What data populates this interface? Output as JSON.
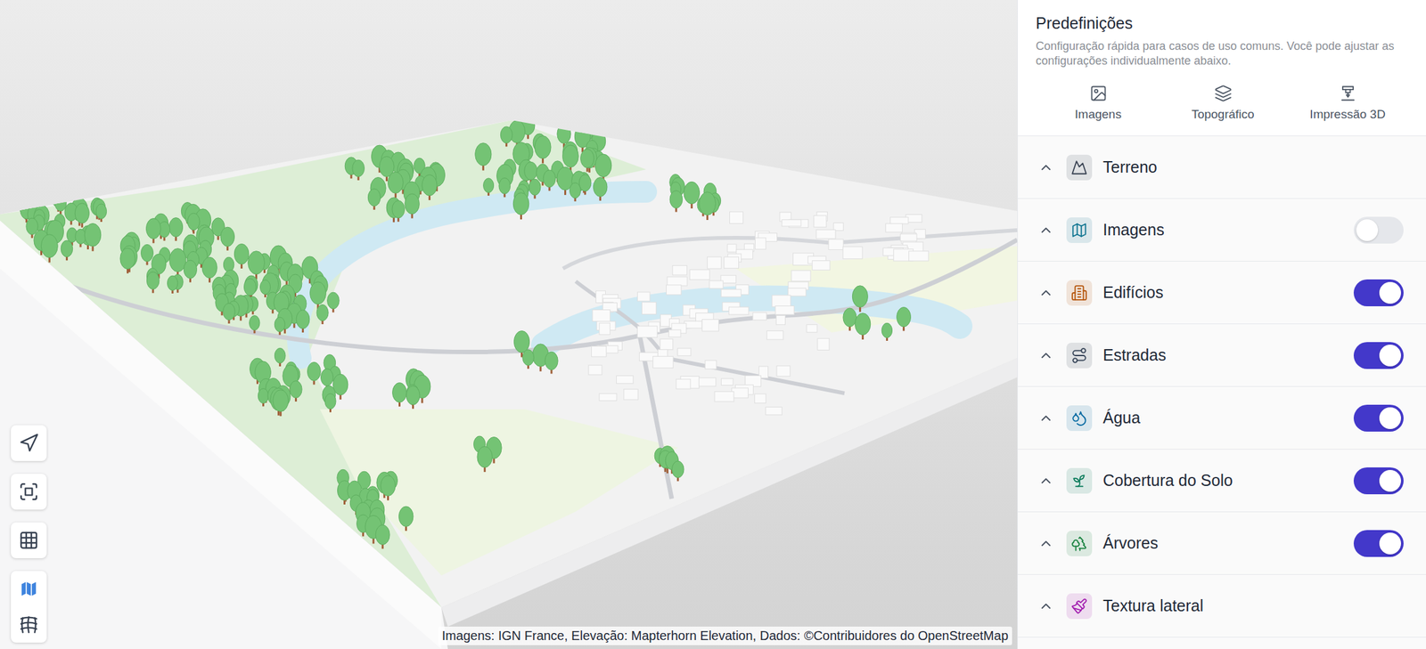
{
  "presets": {
    "title": "Predefinições",
    "description": "Configuração rápida para casos de uso comuns. Você pode ajustar as configurações individualmente abaixo.",
    "items": [
      {
        "label": "Imagens"
      },
      {
        "label": "Topográfico"
      },
      {
        "label": "Impressão 3D"
      }
    ]
  },
  "sections": [
    {
      "label": "Terreno",
      "kind": "plain",
      "collapsed": true,
      "color": "#374151"
    },
    {
      "label": "Imagens",
      "kind": "toggle",
      "on": false,
      "collapsed": true,
      "color": "#0e7490"
    },
    {
      "label": "Edifícios",
      "kind": "toggle",
      "on": true,
      "collapsed": true,
      "color": "#b45309"
    },
    {
      "label": "Estradas",
      "kind": "toggle",
      "on": true,
      "collapsed": true,
      "color": "#334155"
    },
    {
      "label": "Água",
      "kind": "toggle",
      "on": true,
      "collapsed": true,
      "color": "#0369a1"
    },
    {
      "label": "Cobertura do Solo",
      "kind": "toggle",
      "on": true,
      "collapsed": true,
      "color": "#047857"
    },
    {
      "label": "Árvores",
      "kind": "toggle",
      "on": true,
      "collapsed": true,
      "color": "#15803d"
    },
    {
      "label": "Textura lateral",
      "kind": "plain",
      "collapsed": true,
      "color": "#a21caf"
    }
  ],
  "map_tools": [
    {
      "selected": false
    },
    {
      "selected": false
    },
    {
      "selected": false
    },
    {
      "selected": true
    },
    {
      "selected": false
    }
  ],
  "attribution": "Imagens: IGN France, Elevação: Mapterhorn Elevation, Dados: ©Contribuidores do OpenStreetMap"
}
